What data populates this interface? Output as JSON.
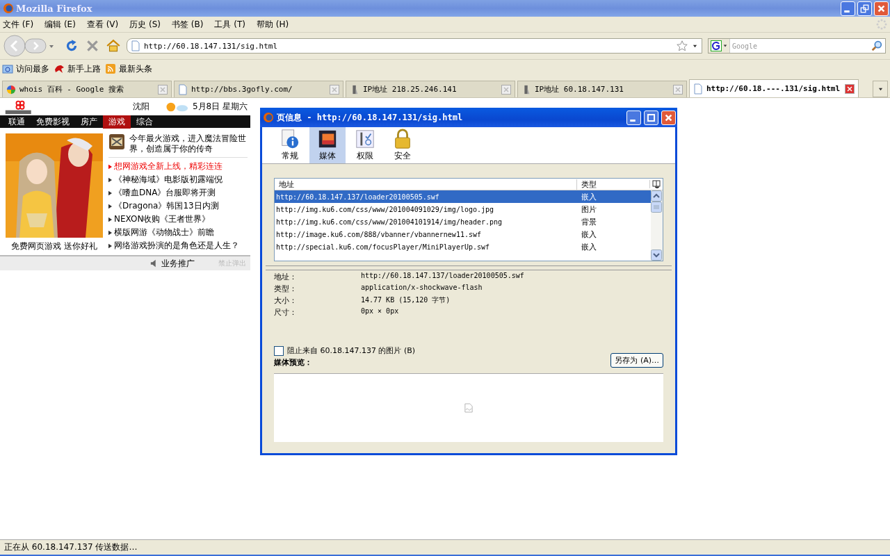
{
  "window": {
    "title": "Mozilla Firefox"
  },
  "menu": [
    "文件 (F)",
    "编辑 (E)",
    "查看 (V)",
    "历史 (S)",
    "书签 (B)",
    "工具 (T)",
    "帮助 (H)"
  ],
  "address": {
    "value": "http://60.18.147.131/sig.html"
  },
  "search": {
    "placeholder": "Google"
  },
  "bookmarks": [
    {
      "label": "访问最多",
      "kind": "folder"
    },
    {
      "label": "新手上路",
      "kind": "bird"
    },
    {
      "label": "最新头条",
      "kind": "feed"
    }
  ],
  "tabs": [
    {
      "label": "whois 百科 - Google 搜索",
      "kind": "google",
      "selected": false
    },
    {
      "label": "http://bbs.3gofly.com/",
      "kind": "page",
      "selected": false
    },
    {
      "label": "IP地址 218.25.246.141",
      "kind": "ip",
      "selected": false
    },
    {
      "label": "IP地址 60.18.147.131",
      "kind": "ip",
      "selected": false
    },
    {
      "label": "http://60.18.---.131/sig.html",
      "kind": "page",
      "selected": true
    }
  ],
  "ad": {
    "city": "沈阳",
    "date": "5月8日 星期六",
    "nav": [
      {
        "label": "联通",
        "selected": false
      },
      {
        "label": "免费影视",
        "selected": false
      },
      {
        "label": "房产",
        "selected": false
      },
      {
        "label": "游戏",
        "selected": true
      },
      {
        "label": "综合",
        "selected": false
      }
    ],
    "headline": "今年最火游戏，进入魔法冒险世界，创造属于你的传奇",
    "caption": "免费网页游戏 送你好礼",
    "links": [
      {
        "text": "想网游戏全新上线，精彩连连",
        "highlight": true
      },
      {
        "text": "《神秘海域》电影版初露端倪",
        "highlight": false
      },
      {
        "text": "《嗜血DNA》台服即将开测",
        "highlight": false
      },
      {
        "text": "《Dragona》韩国13日内测",
        "highlight": false
      },
      {
        "text": "NEXON收购《王者世界》",
        "highlight": false
      },
      {
        "text": "横版网游《动物战士》前瞻",
        "highlight": false
      },
      {
        "text": "网络游戏扮演的是角色还是人生？",
        "highlight": false
      }
    ],
    "promo": "业务推广",
    "close": "禁止弹出"
  },
  "dialog": {
    "title": "页信息 - http://60.18.147.131/sig.html",
    "tabs": [
      {
        "label": "常规",
        "kind": "info",
        "selected": false
      },
      {
        "label": "媒体",
        "kind": "media",
        "selected": true
      },
      {
        "label": "权限",
        "kind": "perm",
        "selected": false
      },
      {
        "label": "安全",
        "kind": "lock",
        "selected": false
      }
    ],
    "columns": [
      "地址",
      "类型"
    ],
    "rows": [
      {
        "address": "http://60.18.147.137/loader20100505.swf",
        "type": "嵌入",
        "selected": true
      },
      {
        "address": "http://img.ku6.com/css/www/201004091029/img/logo.jpg",
        "type": "图片",
        "selected": false
      },
      {
        "address": "http://img.ku6.com/css/www/201004101914/img/header.png",
        "type": "背景",
        "selected": false
      },
      {
        "address": "http://image.ku6.com/888/vbanner/vbannernew11.swf",
        "type": "嵌入",
        "selected": false
      },
      {
        "address": "http://special.ku6.com/focusPlayer/MiniPlayerUp.swf",
        "type": "嵌入",
        "selected": false
      }
    ],
    "details": [
      {
        "label": "地址：",
        "value": "http://60.18.147.137/loader20100505.swf"
      },
      {
        "label": "类型：",
        "value": "application/x-shockwave-flash"
      },
      {
        "label": "大小：",
        "value": "14.77 KB (15,120 字节)"
      },
      {
        "label": "尺寸：",
        "value": "0px × 0px"
      }
    ],
    "block": {
      "label": "阻止来自 60.18.147.137 的图片 (B)",
      "checked": false
    },
    "preview_label": "媒体预览：",
    "save_button": "另存为 (A)…"
  },
  "status_bar": "正在从 60.18.147.137 传送数据…"
}
